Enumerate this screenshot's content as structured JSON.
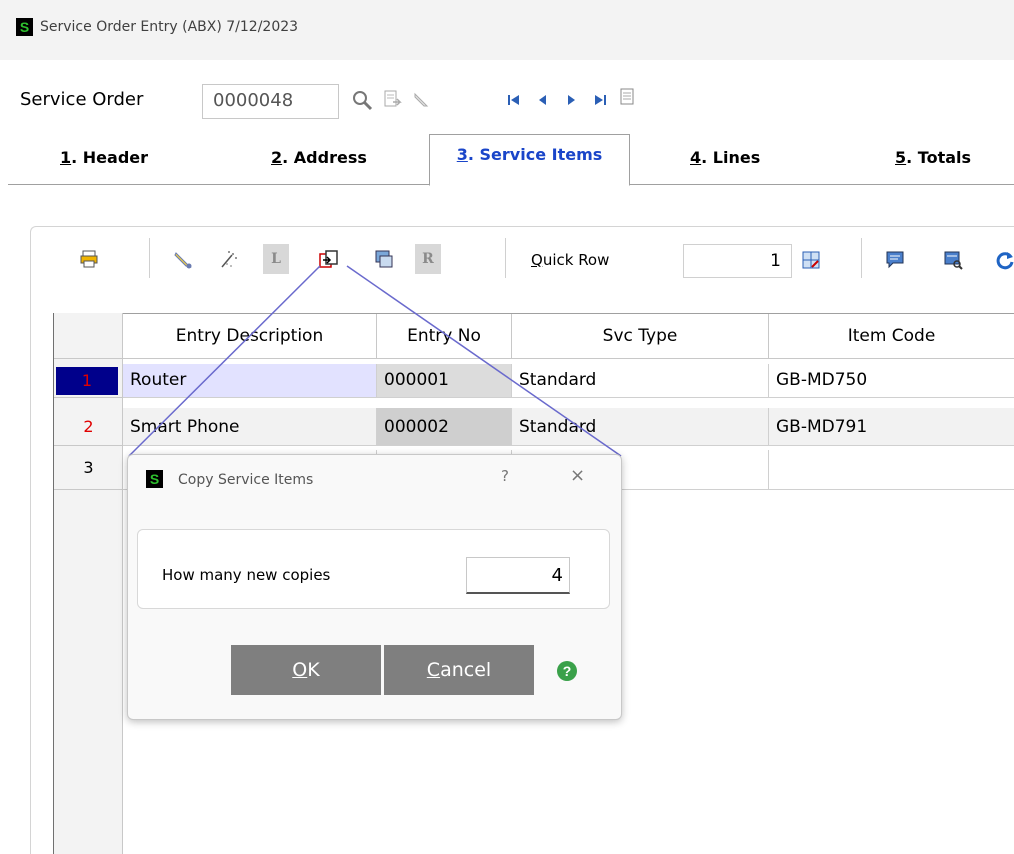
{
  "window": {
    "title": "Service Order Entry (ABX) 7/12/2023",
    "logo_letter": "S"
  },
  "service_order": {
    "label": "Service Order",
    "value": "0000048"
  },
  "tabs": [
    {
      "hotkey": "1",
      "label": ". Header",
      "active": false
    },
    {
      "hotkey": "2",
      "label": ". Address",
      "active": false
    },
    {
      "hotkey": "3",
      "label": ". Service Items",
      "active": true
    },
    {
      "hotkey": "4",
      "label": ". Lines",
      "active": false
    },
    {
      "hotkey": "5",
      "label": ". Totals",
      "active": false
    }
  ],
  "grid_toolbar": {
    "letter_buttons": [
      "L",
      "R"
    ],
    "quick_row_label_hotkey": "Q",
    "quick_row_label_rest": "uick Row",
    "quick_row_value": "1"
  },
  "grid": {
    "columns": [
      "Entry Description",
      "Entry No",
      "Svc Type",
      "Item Code"
    ],
    "rows": [
      {
        "num": "1",
        "description": "Router",
        "entry_no": "000001",
        "svc_type": "Standard",
        "item_code": "GB-MD750"
      },
      {
        "num": "2",
        "description": "Smart Phone",
        "entry_no": "000002",
        "svc_type": "Standard",
        "item_code": "GB-MD791"
      },
      {
        "num": "3",
        "description": "",
        "entry_no": "",
        "svc_type": "",
        "item_code": ""
      }
    ]
  },
  "dialog": {
    "logo_letter": "S",
    "title": "Copy Service Items",
    "help_char": "?",
    "close_char": "×",
    "copies_label": "How many new copies",
    "copies_value": "4",
    "ok_hotkey": "O",
    "ok_rest": "K",
    "cancel_hotkey": "C",
    "cancel_rest": "ancel",
    "help_icon_char": "?"
  },
  "colors": {
    "active_tab": "#1a45c9",
    "row_number": "#e00000",
    "selected_row_number_bg": "#00008b",
    "selected_cell_bg": "#e2e2ff",
    "readonly_cell_bg": "#dcdcdc",
    "dialog_button": "#7f7f7f",
    "callout_line": "#6a6acd"
  }
}
